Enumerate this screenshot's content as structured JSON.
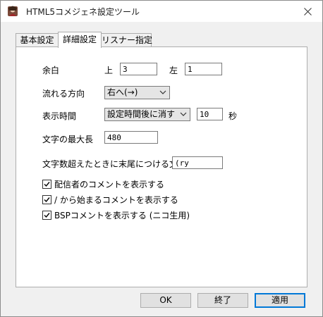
{
  "window": {
    "title": "HTML5コメジェネ設定ツール"
  },
  "tabs": [
    {
      "label": "基本設定"
    },
    {
      "label": "詳細設定"
    },
    {
      "label": "リスナー指定"
    }
  ],
  "margin": {
    "label": "余白",
    "top_label": "上",
    "top_value": "3",
    "left_label": "左",
    "left_value": "1"
  },
  "direction": {
    "label": "流れる方向",
    "value": "右へ(→)"
  },
  "display_time": {
    "label": "表示時間",
    "mode": "設定時間後に消す",
    "seconds": "10",
    "unit": "秒"
  },
  "max_length": {
    "label": "文字の最大長",
    "value": "480"
  },
  "overflow_suffix": {
    "label": "文字数超えたときに末尾につける文字",
    "value": "(ry"
  },
  "checkboxes": [
    {
      "label": "配信者のコメントを表示する",
      "checked": true
    },
    {
      "label": "/ から始まるコメントを表示する",
      "checked": true
    },
    {
      "label": "BSPコメントを表示する (ニコ生用)",
      "checked": true
    }
  ],
  "buttons": {
    "ok": "OK",
    "exit": "終了",
    "apply": "適用"
  },
  "colors": {
    "accent": "#0078d7",
    "panel_bg": "#ffffff",
    "window_bg": "#f0f0f0"
  }
}
